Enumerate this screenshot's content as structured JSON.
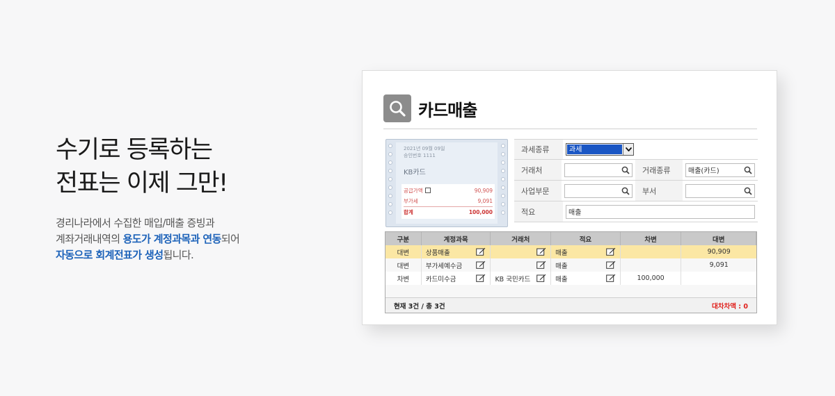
{
  "promo": {
    "headline_line1": "수기로 등록하는",
    "headline_line2": "전표는 이제 그만!",
    "desc_line1": "경리나라에서 수집한 매입/매출 증빙과",
    "desc_line2_a": "계좌거래내역의 ",
    "desc_line2_hl1": "용도가 계정과목과 연동",
    "desc_line2_b": "되어",
    "desc_line3_hl": "자동으로 회계전표가 생성",
    "desc_line3_b": "됩니다."
  },
  "panel": {
    "title": "카드매출",
    "icon": "search-icon"
  },
  "receipt": {
    "date": "2021년 09월 09일",
    "approval": "승인번호 1111",
    "card": "KB카드",
    "lines": [
      {
        "label": "공급가액",
        "value": "90,909"
      },
      {
        "label": "부가세",
        "value": "9,091"
      }
    ],
    "total_label": "합계",
    "total_value": "100,000"
  },
  "form": {
    "tax_type_label": "과세종류",
    "tax_type_value": "과세",
    "vendor_label": "거래처",
    "vendor_value": "",
    "trade_type_label": "거래종류",
    "trade_type_value": "매출(카드)",
    "division_label": "사업부문",
    "division_value": "",
    "dept_label": "부서",
    "dept_value": "",
    "memo_label": "적요",
    "memo_value": "매출"
  },
  "table": {
    "headers": [
      "구분",
      "계정과목",
      "거래처",
      "적요",
      "차변",
      "대변"
    ],
    "rows": [
      {
        "type": "대변",
        "account": "상품매출",
        "vendor": "",
        "memo": "매출",
        "debit": "",
        "credit": "90,909"
      },
      {
        "type": "대변",
        "account": "부가세예수금",
        "vendor": "",
        "memo": "매출",
        "debit": "",
        "credit": "9,091"
      },
      {
        "type": "차변",
        "account": "카드미수금",
        "vendor": "KB 국민카드",
        "memo": "매출",
        "debit": "100,000",
        "credit": ""
      }
    ],
    "footer_count": "현재 3건 / 총 3건",
    "footer_diff": "대차차액 : 0"
  },
  "colors": {
    "accent_blue": "#1c62b9",
    "selected_row": "#fbe7a4",
    "diff_red": "#e0201b"
  }
}
